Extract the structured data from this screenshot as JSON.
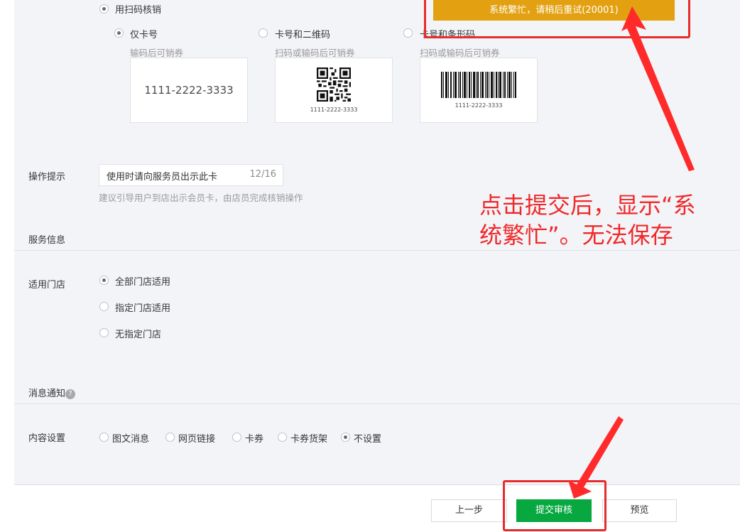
{
  "verify": {
    "scan_option": "用扫码核销",
    "code_types": [
      {
        "label": "仅卡号",
        "hint": "输码后可销券",
        "selected": true
      },
      {
        "label": "卡号和二维码",
        "hint": "扫码或输码后可销券",
        "selected": false
      },
      {
        "label": "卡号和条形码",
        "hint": "扫码或输码后可销券",
        "selected": false
      }
    ],
    "card_number": "1111-2222-3333"
  },
  "tips": {
    "label": "操作提示",
    "value": "使用时请向服务员出示此卡",
    "counter": "12/16",
    "hint": "建议引导用户到店出示会员卡，由店员完成核销操作"
  },
  "service": {
    "title": "服务信息"
  },
  "stores": {
    "label": "适用门店",
    "options": [
      {
        "label": "全部门店适用",
        "selected": true
      },
      {
        "label": "指定门店适用",
        "selected": false
      },
      {
        "label": "无指定门店",
        "selected": false
      }
    ]
  },
  "message": {
    "title": "消息通知",
    "help_icon": "?"
  },
  "content": {
    "label": "内容设置",
    "options": [
      {
        "label": "图文消息",
        "selected": false
      },
      {
        "label": "网页链接",
        "selected": false
      },
      {
        "label": "卡券",
        "selected": false
      },
      {
        "label": "卡券货架",
        "selected": false
      },
      {
        "label": "不设置",
        "selected": true
      }
    ]
  },
  "footer": {
    "prev_label": "上一步",
    "submit_label": "提交审核",
    "preview_label": "预览"
  },
  "toast": {
    "message": "系统繁忙，请稍后重试(20001)",
    "color": "#e3a112"
  },
  "annotation": {
    "line1": "点击提交后，显示“系",
    "line2": "统繁忙”。无法保存",
    "color": "#f02828"
  }
}
